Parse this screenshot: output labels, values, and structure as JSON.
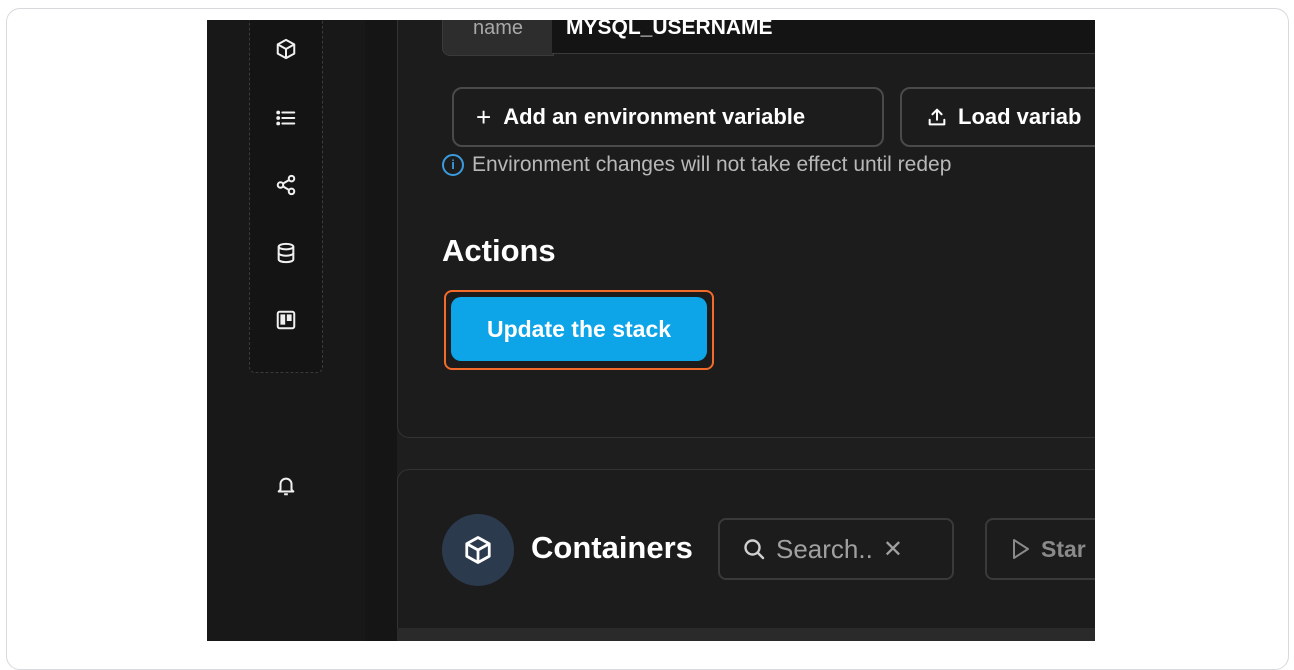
{
  "env": {
    "key_label": "name",
    "value": "MYSQL_USERNAME"
  },
  "buttons": {
    "add_env_icon": "+",
    "add_env_label": "Add an environment variable",
    "load_vars_label": "Load variab"
  },
  "notice": {
    "icon": "i",
    "text": "Environment changes will not take effect until redep"
  },
  "actions": {
    "title": "Actions",
    "update_label": "Update the stack"
  },
  "containers": {
    "title": "Containers",
    "search_placeholder": "Search..",
    "clear_glyph": "✕",
    "start_label": "Star"
  },
  "icons": {
    "sidebar": [
      "cube-icon",
      "list-icon",
      "share-icon",
      "database-icon",
      "board-icon",
      "bell-icon"
    ]
  },
  "colors": {
    "primary": "#0ea4e8",
    "highlight": "#f26b2a",
    "background": "#1e1e1e",
    "info": "#3b9bde"
  }
}
